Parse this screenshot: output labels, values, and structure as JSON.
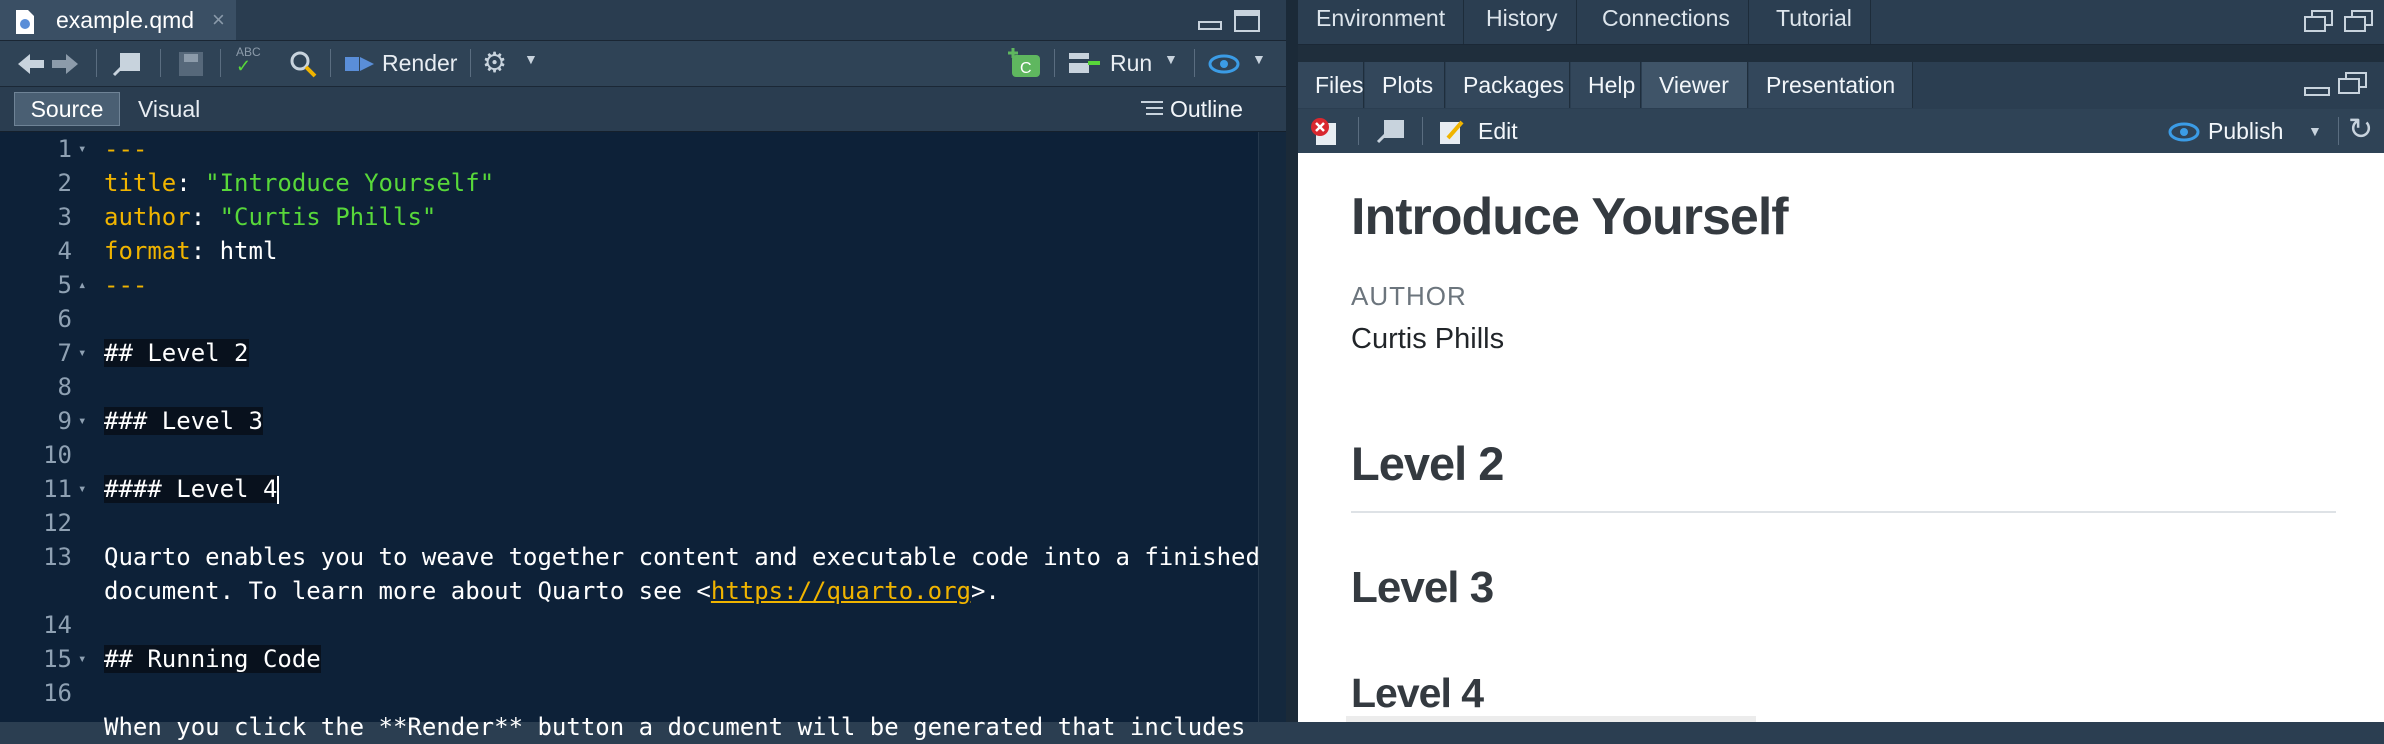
{
  "editor": {
    "tab_name": "example.qmd",
    "toolbar": {
      "render_label": "Render",
      "run_label": "Run"
    },
    "mode_tabs": {
      "source": "Source",
      "visual": "Visual"
    },
    "outline_label": "Outline",
    "lines": [
      {
        "n": "1",
        "fold": "down"
      },
      {
        "n": "2"
      },
      {
        "n": "3"
      },
      {
        "n": "4"
      },
      {
        "n": "5",
        "fold": "up"
      },
      {
        "n": "6"
      },
      {
        "n": "7",
        "fold": "down"
      },
      {
        "n": "8"
      },
      {
        "n": "9",
        "fold": "down"
      },
      {
        "n": "10"
      },
      {
        "n": "11",
        "fold": "down"
      },
      {
        "n": "12"
      },
      {
        "n": "13"
      },
      {
        "n": "14"
      },
      {
        "n": "15",
        "fold": "down"
      },
      {
        "n": "16"
      }
    ],
    "code": {
      "l1": "---",
      "l2_key": "title",
      "l2_val": "\"Introduce Yourself\"",
      "l3_key": "author",
      "l3_val": "\"Curtis Phills\"",
      "l4_key": "format",
      "l4_val": "html",
      "l5": "---",
      "l7": "## Level 2",
      "l9": "### Level 3",
      "l11": "#### Level 4",
      "l13a": "Quarto enables you to weave together content and executable code into a finished",
      "l13b_pre": "document. To learn more about Quarto see <",
      "l13b_link": "https://quarto.org",
      "l13b_post": ">.",
      "l15": "## Running Code",
      "l17_partial": "When you click the **Render** button a document will be generated that includes"
    }
  },
  "right_top_tabs": [
    "Environment",
    "History",
    "Connections",
    "Tutorial"
  ],
  "right_bottom_tabs": [
    "Files",
    "Plots",
    "Packages",
    "Help",
    "Viewer",
    "Presentation"
  ],
  "right_active_tab": "Viewer",
  "viewer_toolbar": {
    "edit_label": "Edit",
    "publish_label": "Publish"
  },
  "viewer": {
    "title": "Introduce Yourself",
    "author_label": "AUTHOR",
    "author_name": "Curtis Phills",
    "h2": "Level 2",
    "h3": "Level 3",
    "h4": "Level 4"
  },
  "colors": {
    "editor_bg": "#0d2138",
    "yaml_key": "#f0b400",
    "string": "#58d83a",
    "link": "#f0b400"
  }
}
